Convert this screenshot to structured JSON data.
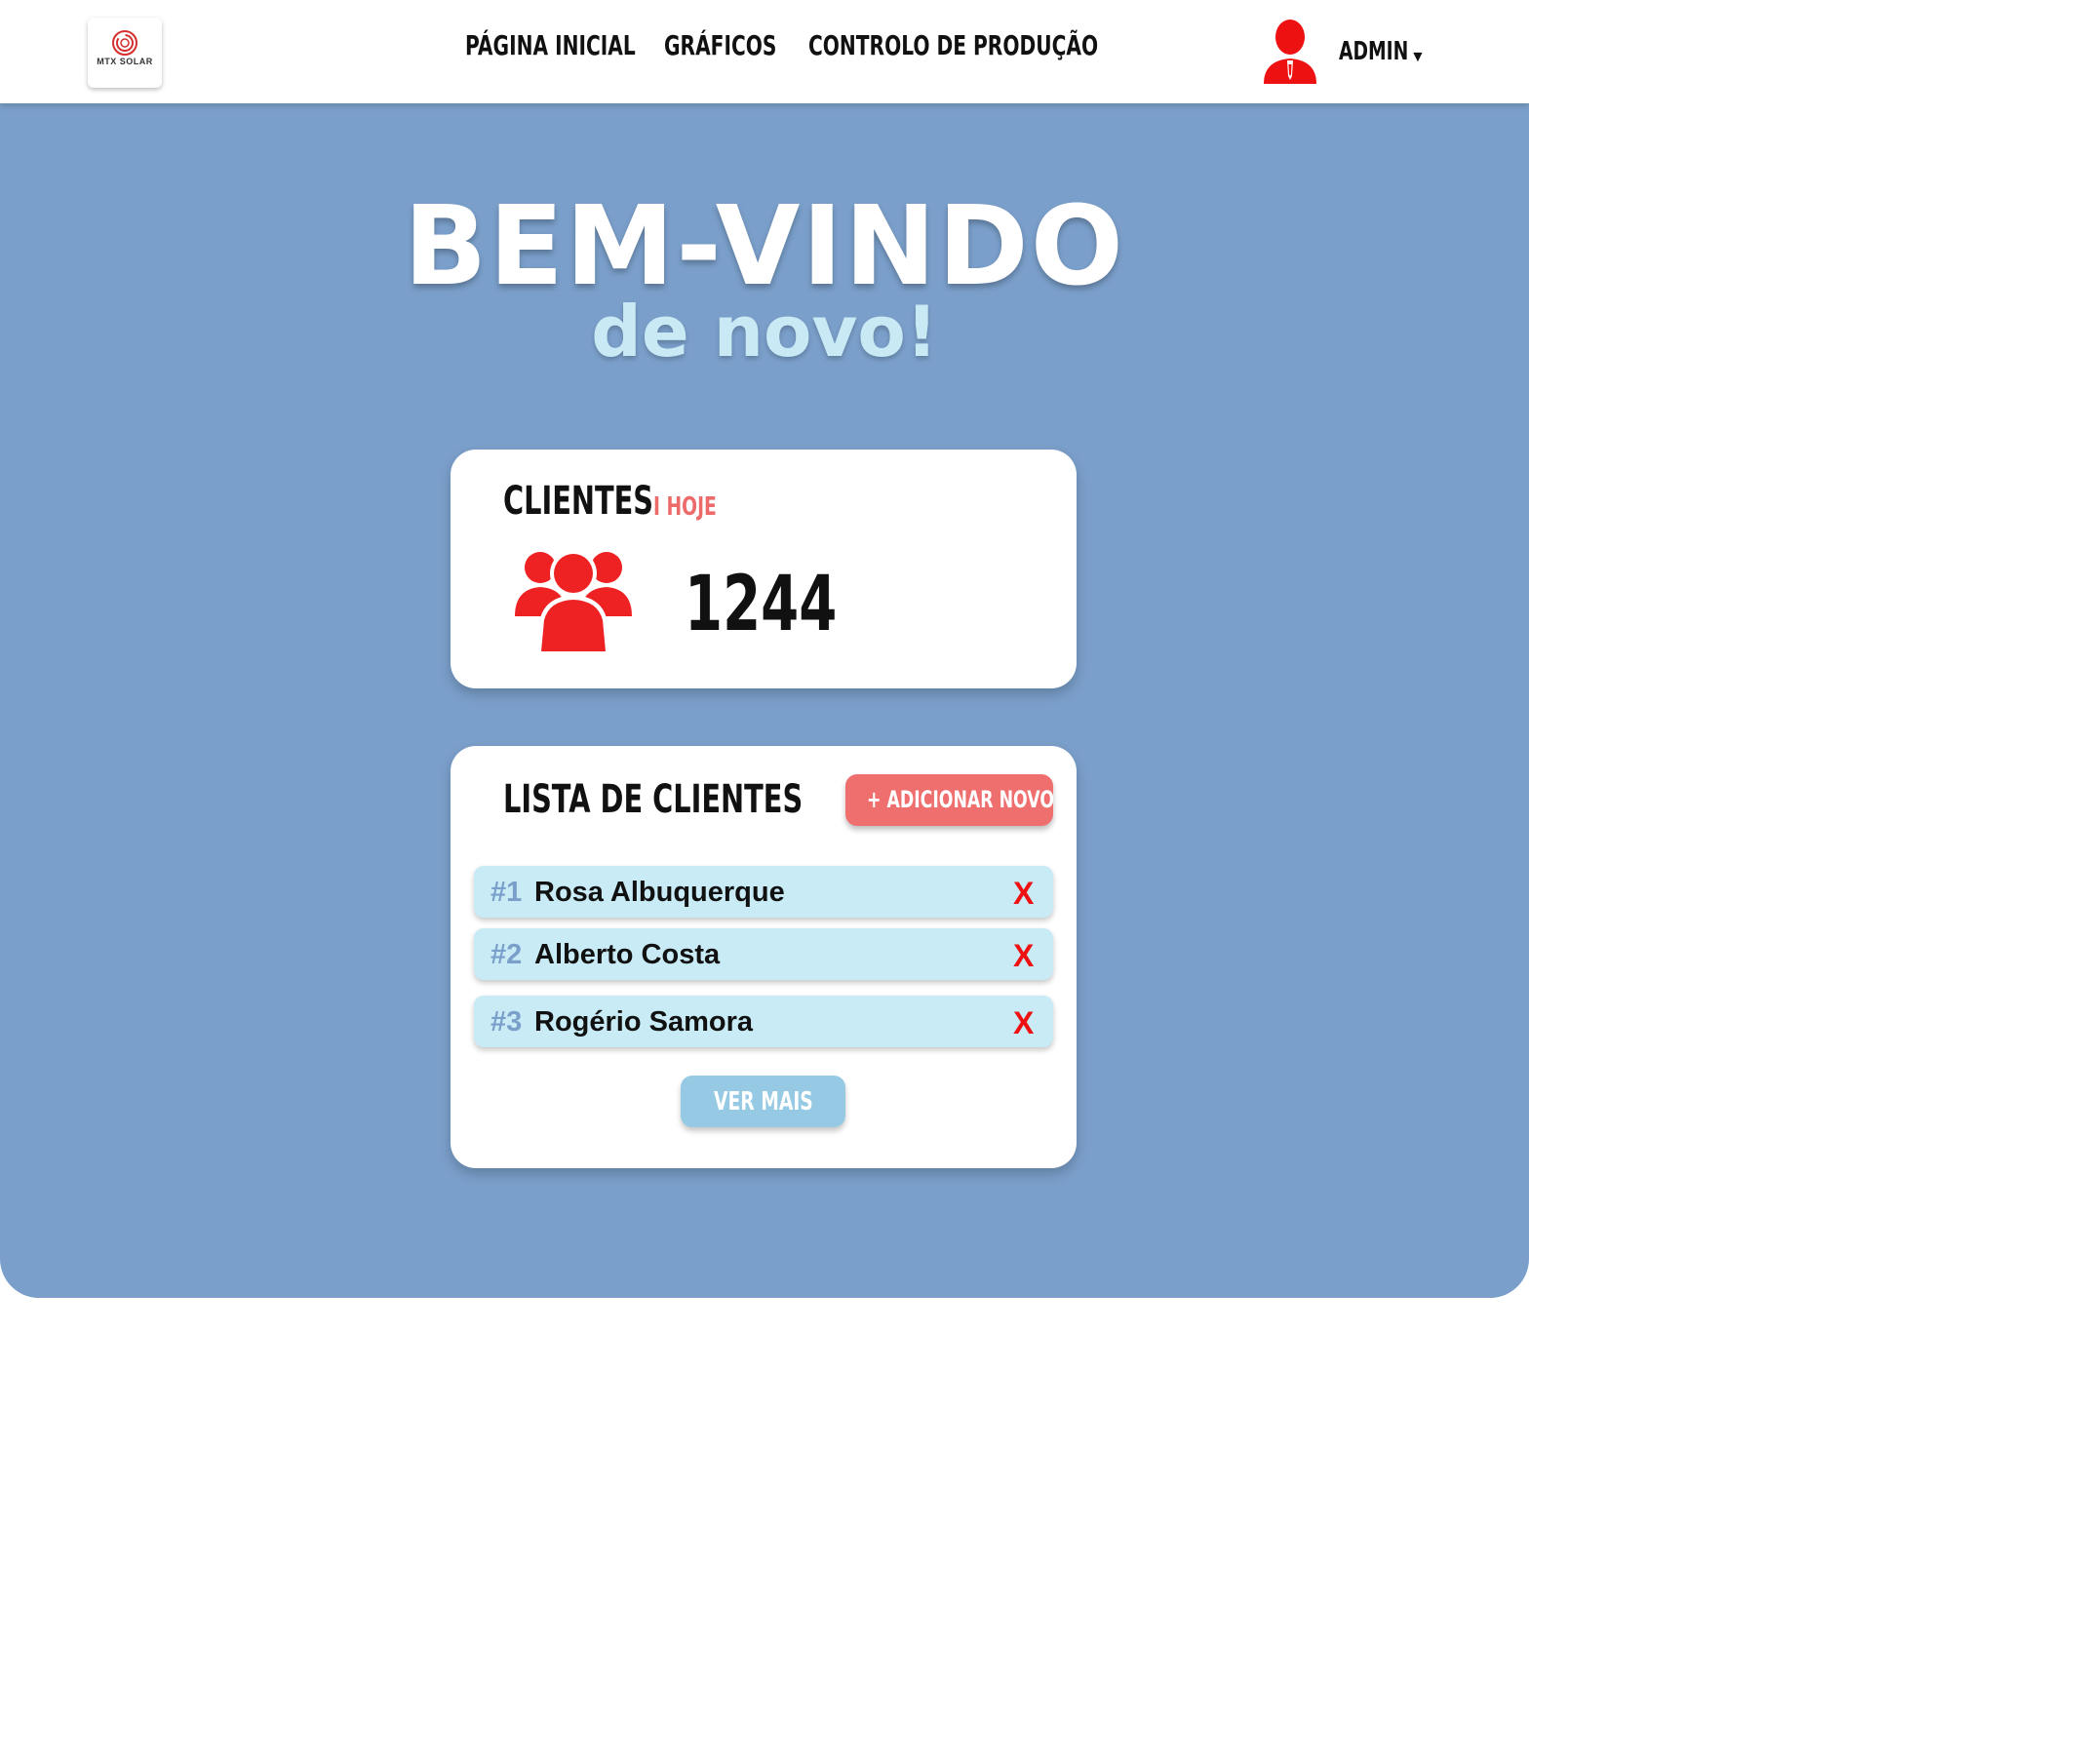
{
  "header": {
    "logo_text": "MTX SOLAR",
    "nav": [
      "PÁGINA INICIAL",
      "GRÁFICOS",
      "CONTROLO DE PRODUÇÃO"
    ],
    "user": {
      "name": "ADMIN",
      "caret": "▼",
      "icon": "user-avatar-icon"
    }
  },
  "hero": {
    "title": "BEM-VINDO",
    "subtitle": "de novo!"
  },
  "clients_card": {
    "title": "CLIENTES",
    "subtitle": "I HOJE",
    "icon": "users-group-icon",
    "count": "1244"
  },
  "client_list": {
    "title": "LISTA DE CLIENTES",
    "add_label": "+ ADICIONAR NOVO",
    "items": [
      {
        "num": "#1",
        "name": "Rosa Albuquerque",
        "remove": "X"
      },
      {
        "num": "#2",
        "name": "Alberto Costa",
        "remove": "X"
      },
      {
        "num": "#3",
        "name": "Rogério Samora",
        "remove": "X"
      }
    ],
    "more_label": "VER MAIS"
  },
  "colors": {
    "background": "#7a9fca",
    "accent_red": "#ee1111",
    "add_button": "#ef6f6f",
    "row_bg": "#c8ebf5",
    "more_button": "#96c9e3",
    "subtitle": "#c9eaf4"
  }
}
